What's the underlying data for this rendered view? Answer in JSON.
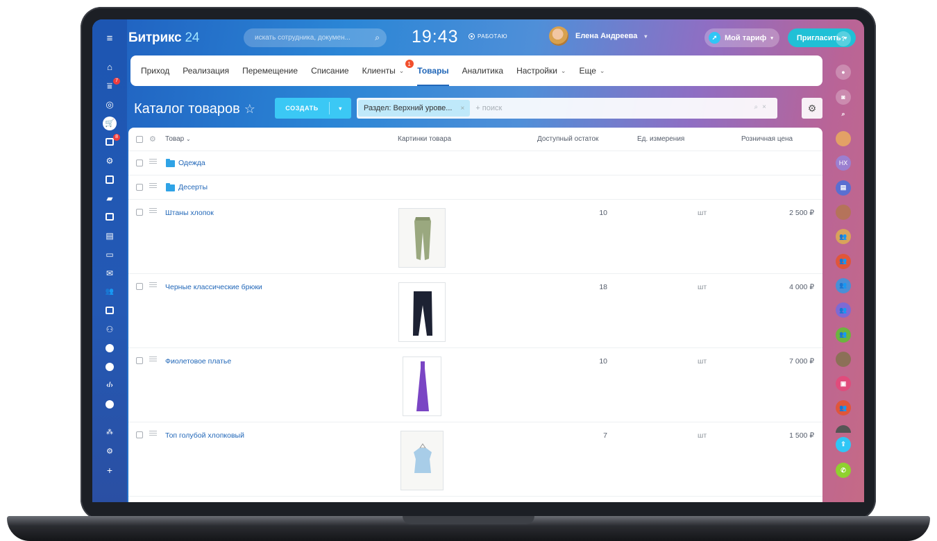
{
  "header": {
    "logo_main": "Битрикс",
    "logo_num": "24",
    "search_placeholder": "искать сотрудника, докумен...",
    "clock": "19:43",
    "work_status": "РАБОТАЮ",
    "user_name": "Елена Андреева",
    "tariff_label": "Мой тариф",
    "invite_label": "Пригласить"
  },
  "left_rail": {
    "badges": {
      "filter": "7",
      "tasks": "8"
    }
  },
  "tabs": [
    {
      "label": "Приход",
      "dropdown": false
    },
    {
      "label": "Реализация",
      "dropdown": false
    },
    {
      "label": "Перемещение",
      "dropdown": false
    },
    {
      "label": "Списание",
      "dropdown": false
    },
    {
      "label": "Клиенты",
      "dropdown": true,
      "badge": "1"
    },
    {
      "label": "Товары",
      "dropdown": false,
      "active": true
    },
    {
      "label": "Аналитика",
      "dropdown": false
    },
    {
      "label": "Настройки",
      "dropdown": true
    },
    {
      "label": "Еще",
      "dropdown": true
    }
  ],
  "toolbar": {
    "page_title": "Каталог товаров",
    "create_label": "СОЗДАТЬ",
    "filter_chip": "Раздел: Верхний урове...",
    "filter_placeholder": "+ поиск"
  },
  "table": {
    "columns": {
      "name": "Товар",
      "pictures": "Картинки товара",
      "stock": "Доступный остаток",
      "unit": "Ед. измерения",
      "price": "Розничная цена"
    },
    "folders": [
      {
        "name": "Одежда"
      },
      {
        "name": "Десерты"
      }
    ],
    "products": [
      {
        "name": "Штаны хлопок",
        "stock": "10",
        "unit": "шт",
        "price": "2 500 ₽",
        "image": "green-trousers"
      },
      {
        "name": "Черные классические брюки",
        "stock": "18",
        "unit": "шт",
        "price": "4 000 ₽",
        "image": "black-trousers"
      },
      {
        "name": "Фиолетовое платье",
        "stock": "10",
        "unit": "шт",
        "price": "7 000 ₽",
        "image": "purple-dress"
      },
      {
        "name": "Топ голубой хлопковый",
        "stock": "7",
        "unit": "шт",
        "price": "1 500 ₽",
        "image": "blue-top"
      }
    ]
  },
  "right_rail": {
    "initials": "НХ"
  },
  "colors": {
    "accent": "#2167b8",
    "create_button": "#3bc8f5",
    "invite_button": "#20c0d6",
    "badge": "#ef3d3d"
  }
}
